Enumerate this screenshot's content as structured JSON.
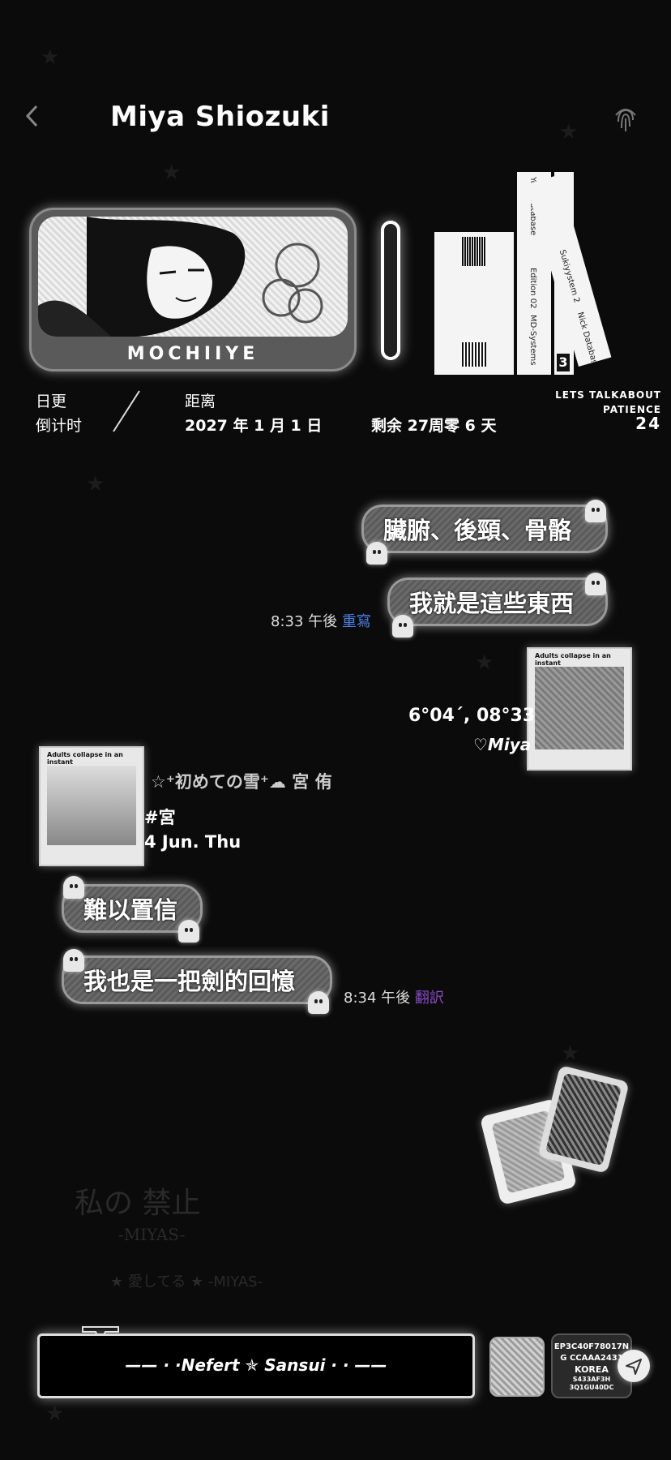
{
  "header": {
    "title": "Miya Shiozuki"
  },
  "banner": {
    "label": "MOCHIIYE"
  },
  "books": {
    "spines": [
      "Your Database",
      "Edition 02",
      "MD-Systems",
      "Sukiyystem 2",
      "Nick Database"
    ],
    "spine_number": "3"
  },
  "info": {
    "label_a1": "日更",
    "label_a2": "倒计时",
    "label_b": "距离",
    "date": "2027 年 1 月 1 日",
    "remaining": "剩余 27周零 6 天",
    "lets_line1": "LETS TALKABOUT",
    "lets_line2": "PATIENCE",
    "lets_number": "24"
  },
  "messages": {
    "out1": "臟腑、後頸、骨骼",
    "out2": "我就是這些東西",
    "out_time": "8:33 午後",
    "out_action": "重寫",
    "in1": "難以置信",
    "in2": "我也是一把劍的回憶",
    "in_time": "8:34 午後",
    "in_action": "翻訳"
  },
  "photo_post": {
    "coords": "6°04´, 08°33",
    "signature": "♡Miya",
    "caption_top": "Adults collapse in an instant"
  },
  "profile_post": {
    "line1": "☆⁺初めての雪⁺☁ 宮 侑",
    "line2": "#宮",
    "line3": "4 Jun. Thu"
  },
  "watermark": {
    "line1": "私の 禁止",
    "line2": "-MIYAS-",
    "line3": "★ 愛してる ★ -MIYAS-"
  },
  "bottom": {
    "bar_text": "——  · ·Nefert ✯ Sansui · ·  ——",
    "ticket_line1": "EP3C40F78017N",
    "ticket_line2": "G CCAAA2431",
    "ticket_line3": "KOREA",
    "ticket_line4": "S433AF3H",
    "ticket_line5": "3Q1GU40DC"
  },
  "icons": [
    "back-chevron-icon",
    "fingerprint-icon",
    "ghost-icon",
    "send-icon",
    "star-icon"
  ]
}
